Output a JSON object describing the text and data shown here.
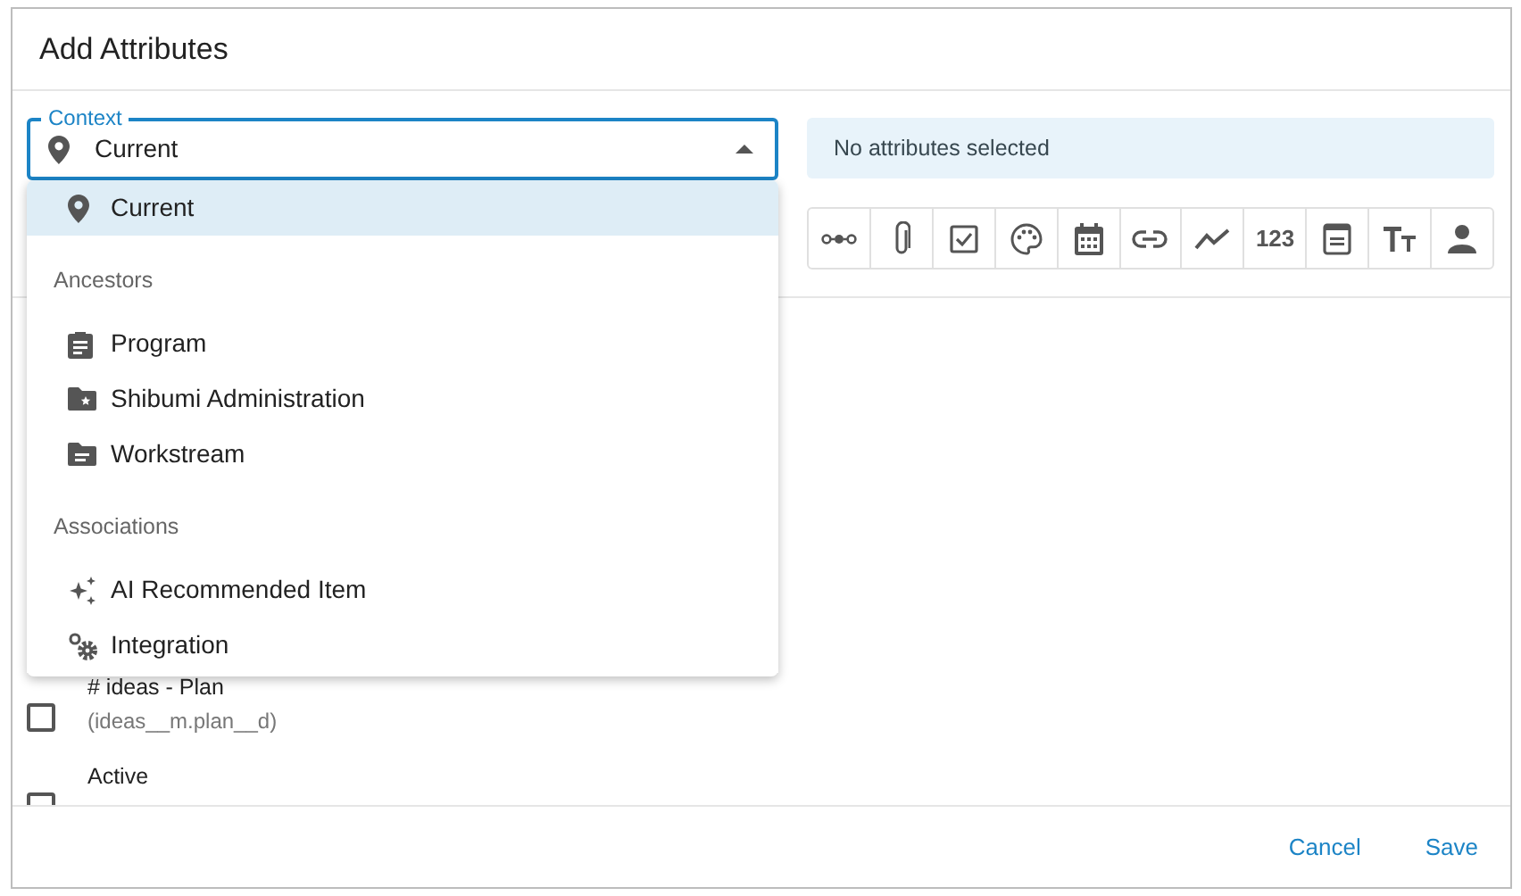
{
  "dialog": {
    "title": "Add Attributes"
  },
  "context_field": {
    "label": "Context",
    "value": "Current",
    "expanded": true
  },
  "dropdown": {
    "items": [
      {
        "kind": "option",
        "label": "Current",
        "selected": true
      },
      {
        "kind": "header",
        "label": "Ancestors"
      },
      {
        "kind": "option",
        "label": "Program",
        "selected": false
      },
      {
        "kind": "option",
        "label": "Shibumi Administration",
        "selected": false
      },
      {
        "kind": "option",
        "label": "Workstream",
        "selected": false
      },
      {
        "kind": "header",
        "label": "Associations"
      },
      {
        "kind": "option",
        "label": "AI Recommended Item",
        "selected": false
      },
      {
        "kind": "option",
        "label": "Integration",
        "selected": false
      }
    ]
  },
  "selection_banner": {
    "text": "No attributes selected"
  },
  "type_filters": [
    {
      "kind": "relation"
    },
    {
      "kind": "attachment"
    },
    {
      "kind": "checkbox"
    },
    {
      "kind": "palette"
    },
    {
      "kind": "calendar"
    },
    {
      "kind": "link"
    },
    {
      "kind": "trend"
    },
    {
      "kind": "number",
      "label": "123"
    },
    {
      "kind": "form"
    },
    {
      "kind": "text"
    },
    {
      "kind": "person"
    }
  ],
  "attributes": [
    {
      "name": "# ideas - Plan",
      "field": "(ideas__m.plan__d)",
      "checked": false
    },
    {
      "name": "Active",
      "checked": false
    }
  ],
  "buttons": [
    "Cancel",
    "Save"
  ]
}
